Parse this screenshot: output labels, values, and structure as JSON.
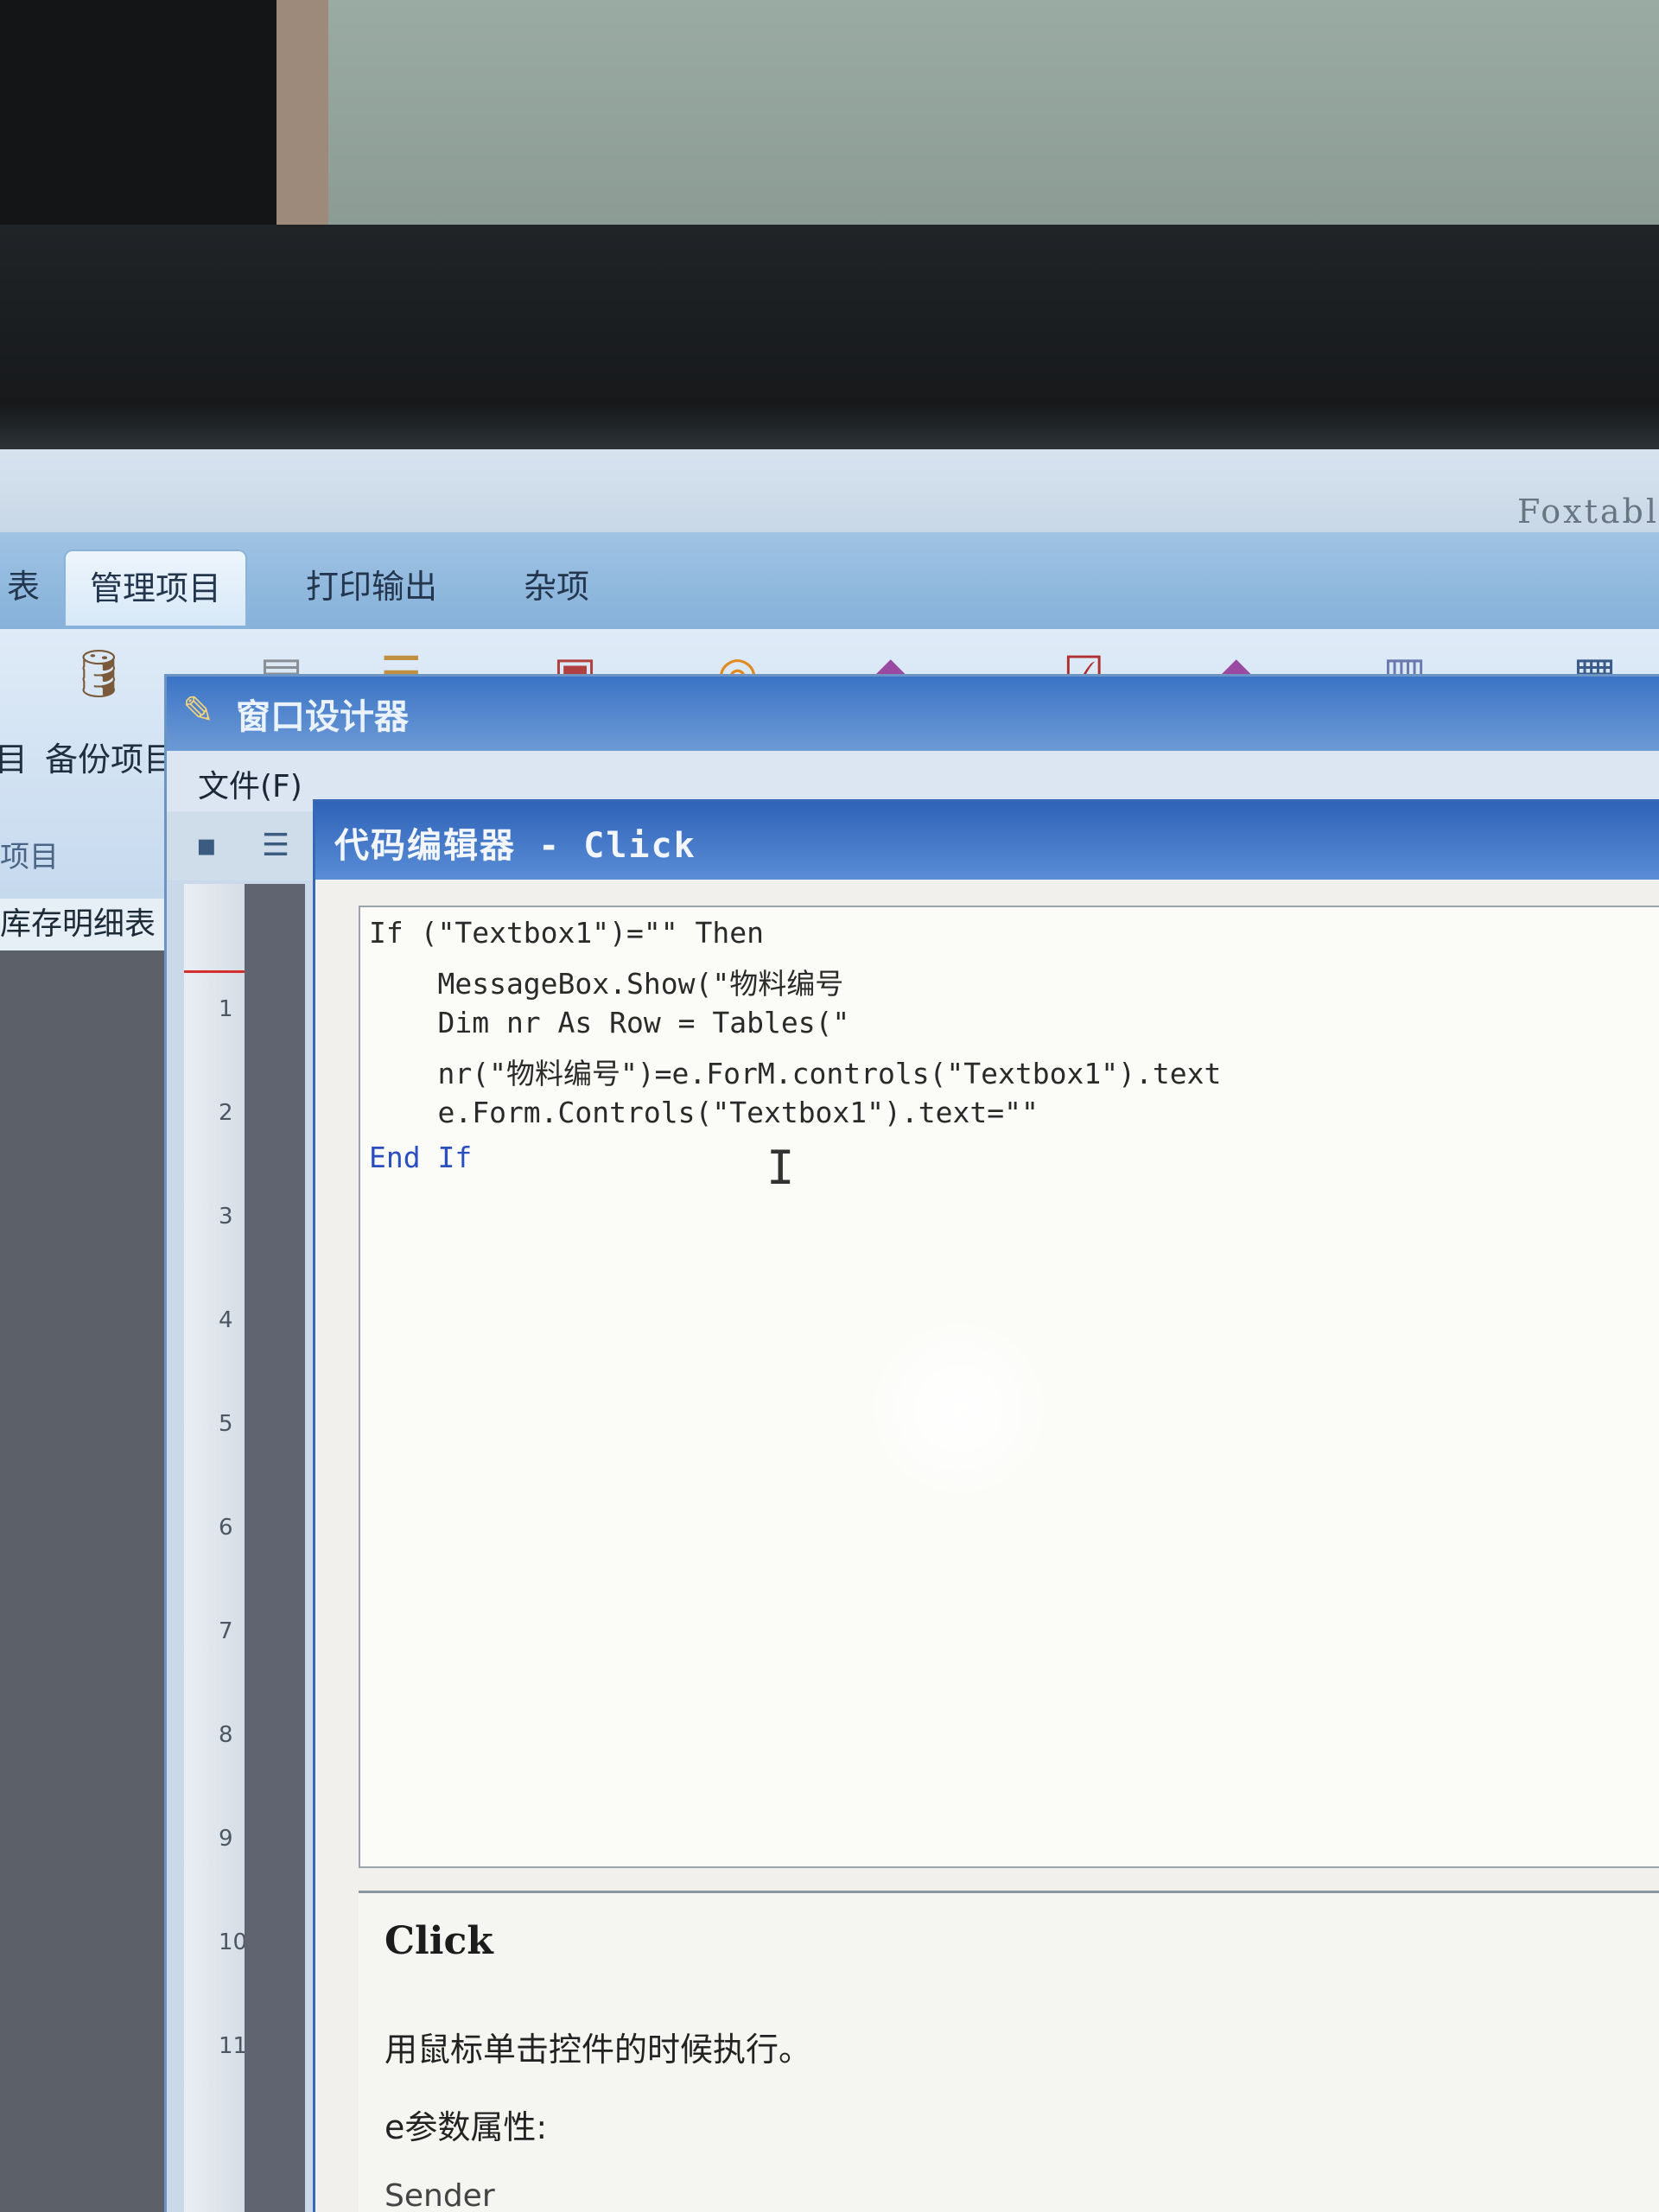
{
  "app": {
    "title": "Foxtabl",
    "tabs": [
      "表",
      "管理项目",
      "打印输出",
      "杂项"
    ],
    "ribbon_labels": [
      "目",
      "备份项目"
    ],
    "group_label": "项目",
    "left_tab": "库存明细表"
  },
  "designer": {
    "title": "窗口设计器",
    "menu": "文件(F)"
  },
  "editor": {
    "title": "代码编辑器 - Click",
    "code_lines": [
      "If (\"Textbox1\")=\"\" Then",
      "    MessageBox.Show(\"物料编号",
      "    Dim nr As Row = Tables(\"",
      "    nr(\"物料编号\")=e.ForM.controls(\"Textbox1\").text",
      "    e.Form.Controls(\"Textbox1\").text=\"\"",
      "End If"
    ],
    "help_title": "Click",
    "help_description": "用鼠标单击控件的时候执行。",
    "help_params": "e参数属性:",
    "help_sender": "Sender"
  },
  "ruler_numbers": [
    "1",
    "2",
    "3",
    "4",
    "5",
    "6",
    "7",
    "8",
    "9",
    "10",
    "11"
  ],
  "colors": {
    "titlebar": "#2f63b8",
    "keyword": "#2a4fbf",
    "string": "#c03a3a"
  }
}
